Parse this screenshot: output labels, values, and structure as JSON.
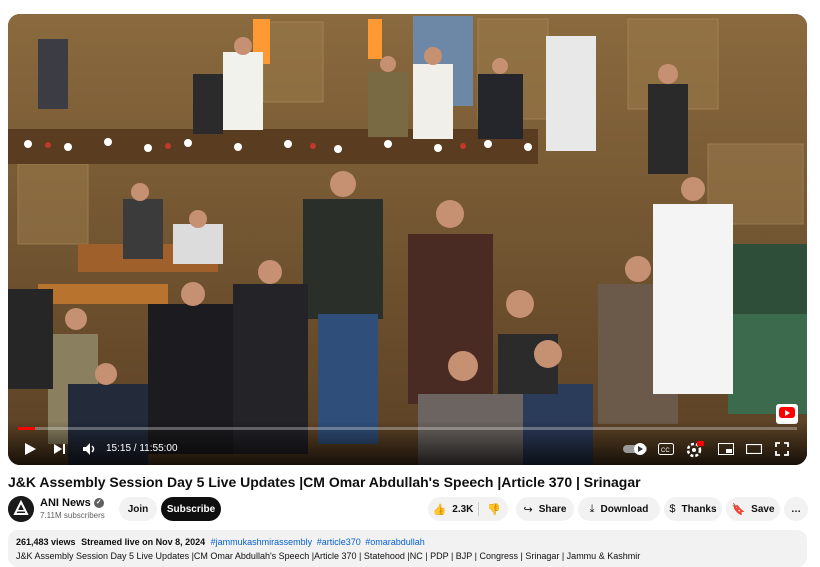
{
  "player": {
    "current_time": "15:15",
    "duration": "11:55:00",
    "time_display": "15:15 / 11:55:00",
    "progress_fraction": 0.022,
    "icons": [
      "play-icon",
      "next-icon",
      "volume-icon",
      "autoplay-toggle",
      "subtitles-icon",
      "settings-icon",
      "miniplayer-icon",
      "theater-icon",
      "fullscreen-icon"
    ],
    "hd_badge": "HD",
    "accent": "#ff0000"
  },
  "video": {
    "title": "J&K Assembly Session Day 5 Live Updates |CM Omar Abdullah's Speech |Article 370 | Srinagar"
  },
  "channel": {
    "name": "ANI News",
    "subscribers": "7.11M subscribers",
    "join_label": "Join",
    "subscribe_label": "Subscribe"
  },
  "actions": {
    "likes": "2.3K",
    "share_label": "Share",
    "download_label": "Download",
    "thanks_label": "Thanks",
    "save_label": "Save",
    "more_label": "…"
  },
  "description": {
    "views": "261,483 views",
    "streamed": "Streamed live on Nov 8, 2024",
    "hashtags": [
      "#jammukashmirassembly",
      "#article370",
      "#omarabdullah"
    ],
    "text": "J&K Assembly Session Day 5 Live Updates |CM Omar Abdullah's Speech |Article 370 | Statehood |NC | PDP | BJP | Congress | Srinagar | Jammu & Kashmir"
  }
}
